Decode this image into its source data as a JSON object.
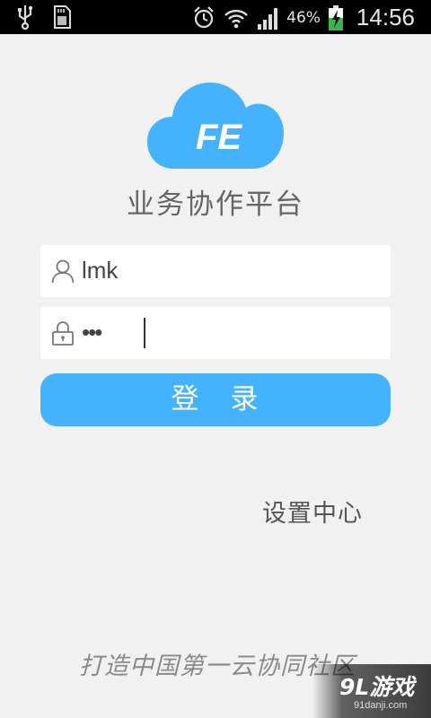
{
  "status_bar": {
    "left_icons": [
      "usb-icon",
      "sd-card-icon"
    ],
    "right_icons": [
      "alarm-icon",
      "wifi-icon",
      "signal-icon"
    ],
    "battery_percent": "46%",
    "battery_icon": "battery-charging-icon",
    "time": "14:56"
  },
  "logo": {
    "icon": "cloud-logo-icon",
    "text": "FE",
    "color": "#45b2fd"
  },
  "app": {
    "title": "业务协作平台"
  },
  "login_form": {
    "username": {
      "value": "lmk",
      "icon": "user-icon"
    },
    "password": {
      "value": "•••",
      "icon": "lock-icon"
    },
    "submit_label": "登　录"
  },
  "settings": {
    "label": "设置中心"
  },
  "footer": {
    "slogan": "打造中国第一云协同社区"
  },
  "watermark": {
    "brand": "9L游戏",
    "url": "91danji.com"
  },
  "colors": {
    "accent": "#45b2fd",
    "background": "#f1f1f1"
  }
}
